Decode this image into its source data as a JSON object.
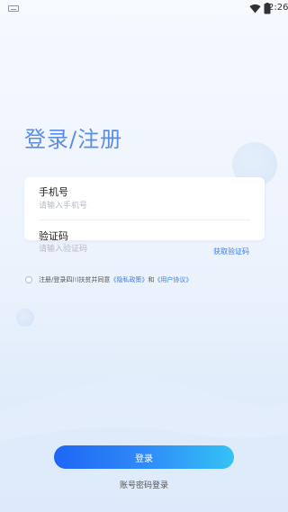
{
  "status_bar": {
    "time": "2:26",
    "icons": [
      "keyboard-icon",
      "wifi-icon",
      "battery-icon"
    ]
  },
  "page": {
    "title": "登录/注册"
  },
  "form": {
    "phone": {
      "label": "手机号",
      "placeholder": "请输入手机号",
      "value": ""
    },
    "code": {
      "label": "验证码",
      "placeholder": "请输入验证码",
      "value": "",
      "get_code_label": "获取验证码"
    }
  },
  "agreement": {
    "checked": false,
    "text_prefix": "注册/登录四川扶贫并同意",
    "privacy_link": "《隐私政策》",
    "conjunction": "和",
    "user_link": "《用户协议》"
  },
  "actions": {
    "login_label": "登录",
    "password_login_label": "账号密码登录"
  },
  "colors": {
    "accent": "#3d7ce6",
    "title": "#5b8de6",
    "button_start": "#1e66f5",
    "button_end": "#34c2f5"
  }
}
